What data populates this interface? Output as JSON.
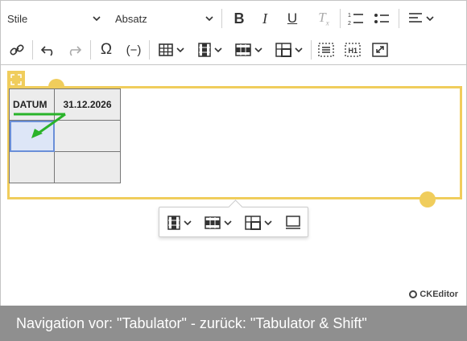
{
  "toolbar": {
    "style_dropdown": "Stile",
    "heading_dropdown": "Absatz",
    "icons_row1": [
      "bold-icon",
      "italic-icon",
      "underline-icon",
      "remove-format-icon",
      "numbered-list-icon",
      "bulleted-list-icon",
      "alignment-icon"
    ],
    "icons_row2": [
      "link-icon",
      "undo-icon",
      "redo-icon",
      "special-characters-icon",
      "formula-icon",
      "insert-table-icon",
      "table-column-icon",
      "table-row-icon",
      "merge-cells-icon",
      "show-blocks-icon",
      "heading-one-icon",
      "maximize-icon"
    ]
  },
  "table": {
    "rows": [
      [
        "DATUM",
        "31.12.2026"
      ],
      [
        "",
        ""
      ],
      [
        "",
        ""
      ]
    ]
  },
  "balloon": {
    "icons": [
      "table-column-icon",
      "table-row-icon",
      "merge-cells-icon",
      "table-properties-icon"
    ]
  },
  "branding": {
    "logo_text": "CKEditor"
  },
  "caption": {
    "text": "Navigation vor: \"Tabulator\" - zurück: \"Tabulator & Shift\""
  },
  "colors": {
    "widget_outline": "#f0cd5c",
    "arrow": "#2ab32a",
    "selected_cell": "#dde6f7"
  }
}
